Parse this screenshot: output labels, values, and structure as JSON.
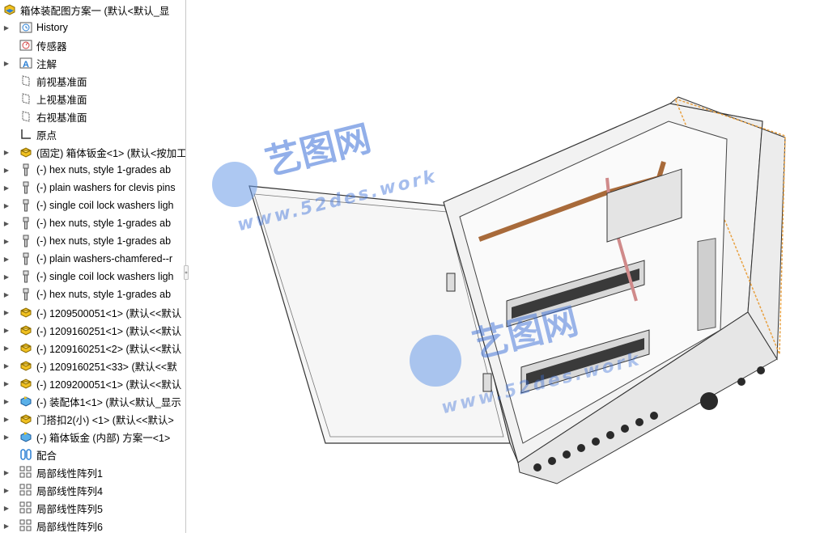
{
  "tree": {
    "root": {
      "label": "箱体装配图方案一 (默认<默认_显",
      "icon": "assembly-icon"
    },
    "items": [
      {
        "label": "History",
        "icon": "history-icon",
        "expandable": true
      },
      {
        "label": "传感器",
        "icon": "sensor-icon",
        "expandable": false
      },
      {
        "label": "注解",
        "icon": "annotation-icon",
        "expandable": true
      },
      {
        "label": "前视基准面",
        "icon": "plane-icon",
        "expandable": false
      },
      {
        "label": "上视基准面",
        "icon": "plane-icon",
        "expandable": false
      },
      {
        "label": "右视基准面",
        "icon": "plane-icon",
        "expandable": false
      },
      {
        "label": "原点",
        "icon": "origin-icon",
        "expandable": false
      },
      {
        "label": "(固定) 箱体钣金<1> (默认<按加工",
        "icon": "part-icon",
        "expandable": true
      },
      {
        "label": "(-) hex nuts, style 1-grades ab",
        "icon": "toolbox-part-icon",
        "expandable": true
      },
      {
        "label": "(-) plain washers for clevis pins",
        "icon": "toolbox-part-icon",
        "expandable": true
      },
      {
        "label": "(-) single coil lock washers ligh",
        "icon": "toolbox-part-icon",
        "expandable": true
      },
      {
        "label": "(-) hex nuts, style 1-grades ab",
        "icon": "toolbox-part-icon",
        "expandable": true
      },
      {
        "label": "(-) hex nuts, style 1-grades ab",
        "icon": "toolbox-part-icon",
        "expandable": true
      },
      {
        "label": "(-) plain washers-chamfered--r",
        "icon": "toolbox-part-icon",
        "expandable": true
      },
      {
        "label": "(-) single coil lock washers ligh",
        "icon": "toolbox-part-icon",
        "expandable": true
      },
      {
        "label": "(-) hex nuts, style 1-grades ab",
        "icon": "toolbox-part-icon",
        "expandable": true
      },
      {
        "label": "(-) 1209500051<1> (默认<<默认",
        "icon": "part-icon",
        "expandable": true
      },
      {
        "label": "(-) 1209160251<1> (默认<<默认",
        "icon": "part-icon",
        "expandable": true
      },
      {
        "label": "(-) 1209160251<2> (默认<<默认",
        "icon": "part-icon",
        "expandable": true
      },
      {
        "label": "(-) 1209160251<33> (默认<<默",
        "icon": "part-icon",
        "expandable": true
      },
      {
        "label": "(-) 1209200051<1> (默认<<默认",
        "icon": "part-icon",
        "expandable": true
      },
      {
        "label": "(-) 装配体1<1> (默认<默认_显示",
        "icon": "subassembly-icon",
        "expandable": true
      },
      {
        "label": "门搭扣2(小) <1> (默认<<默认>",
        "icon": "part-icon",
        "expandable": true
      },
      {
        "label": "(-) 箱体钣金 (内部) 方案一<1>",
        "icon": "subassembly-icon",
        "expandable": true
      },
      {
        "label": "配合",
        "icon": "mate-icon",
        "expandable": false
      },
      {
        "label": "局部线性阵列1",
        "icon": "pattern-icon",
        "expandable": true
      },
      {
        "label": "局部线性阵列4",
        "icon": "pattern-icon",
        "expandable": true
      },
      {
        "label": "局部线性阵列5",
        "icon": "pattern-icon",
        "expandable": true
      },
      {
        "label": "局部线性阵列6",
        "icon": "pattern-icon",
        "expandable": true
      }
    ]
  },
  "watermark": {
    "cn": "艺图网",
    "url_top": "www.52des.work",
    "url_mid": "www.52des.work"
  },
  "colors": {
    "part": "#f0c020",
    "assembly_blue": "#2a7fd4",
    "watermark": "#3a6fd8",
    "busbar": "#a86a3a",
    "selection_orange": "#e8a040"
  }
}
